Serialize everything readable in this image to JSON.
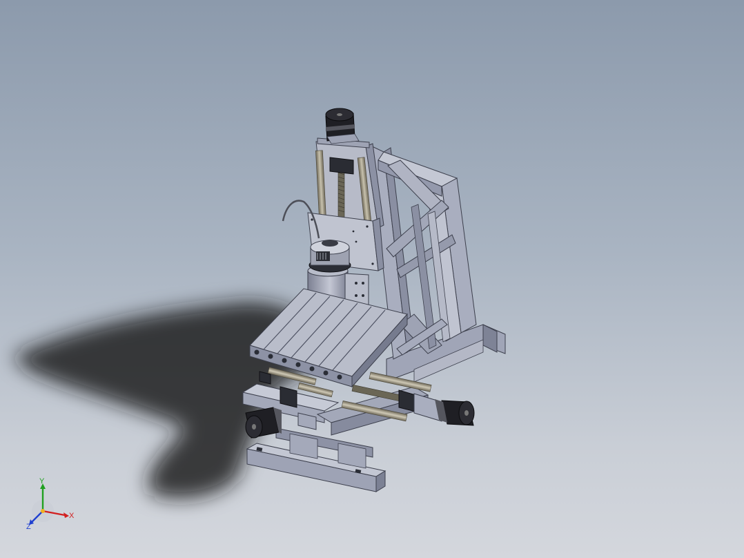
{
  "viewport": {
    "background_top": "#8c9aac",
    "background_bottom": "#d4d7dd"
  },
  "model": {
    "frame_color": "#a7acbd",
    "frame_shade": "#7d8296",
    "frame_dark": "#5b5f70",
    "motor_color": "#1e1e22",
    "rod_color": "#9b9482"
  },
  "triad": {
    "x_label": "X",
    "y_label": "Y",
    "z_label": "Z",
    "x_color": "#d22020",
    "y_color": "#20a020",
    "z_color": "#2040d0"
  }
}
